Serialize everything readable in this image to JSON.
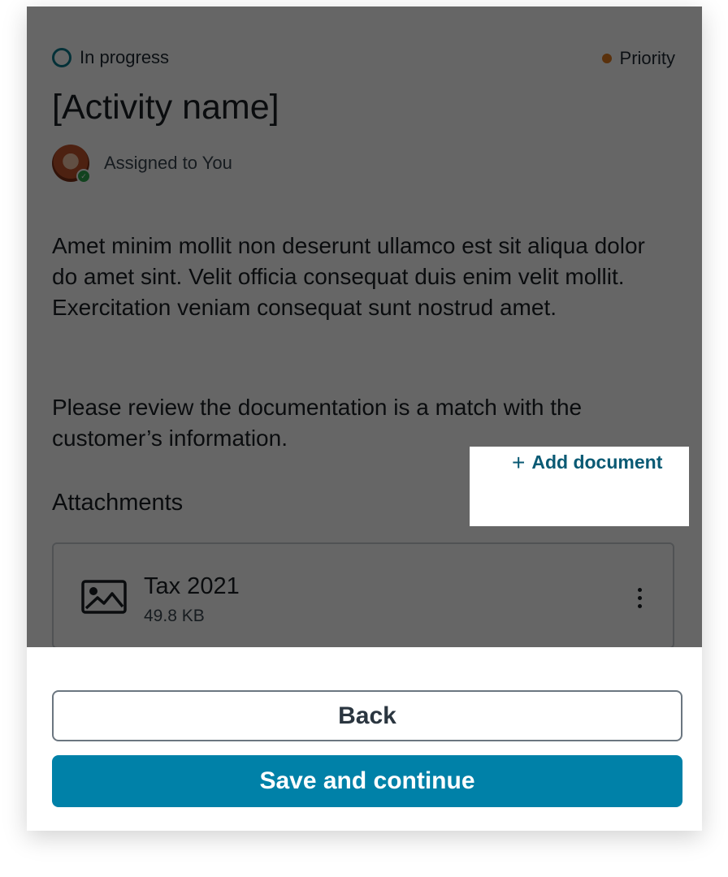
{
  "status": {
    "label": "In progress"
  },
  "priority": {
    "label": "Priority",
    "color": "#e07a1f"
  },
  "activity": {
    "title": "[Activity name]",
    "assigned_label": "Assigned to You",
    "description": "Amet minim mollit non deserunt ullamco est sit aliqua dolor do amet sint. Velit officia consequat duis enim velit mollit. Exercitation veniam consequat sunt nostrud amet.",
    "instruction": "Please review the documentation is a match with the customer’s information."
  },
  "attachments": {
    "heading": "Attachments",
    "add_label": "Add document",
    "add_icon": "plus-icon",
    "files": [
      {
        "name": "Tax 2021",
        "size": "49.8 KB",
        "icon": "image-icon"
      }
    ]
  },
  "footer": {
    "back_label": "Back",
    "save_label": "Save and continue",
    "save_color": "#0081a8"
  }
}
